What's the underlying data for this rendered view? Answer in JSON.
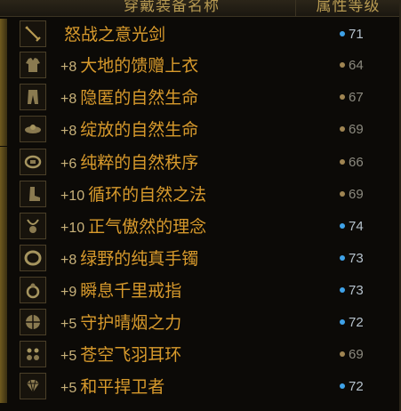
{
  "header": {
    "name_col": "穿戴装备名称",
    "attr_col": "属性等级"
  },
  "rows": [
    {
      "plus": "",
      "name": "怒战之意光剑",
      "level": "71",
      "dot": "blue",
      "icon": "sword-icon"
    },
    {
      "plus": "+8",
      "name": "大地的馈赠上衣",
      "level": "64",
      "dot": "gold",
      "icon": "coat-icon"
    },
    {
      "plus": "+8",
      "name": "隐匿的自然生命",
      "level": "67",
      "dot": "gold",
      "icon": "pants-icon"
    },
    {
      "plus": "+8",
      "name": "绽放的自然生命",
      "level": "69",
      "dot": "gold",
      "icon": "shoulder-icon"
    },
    {
      "plus": "+6",
      "name": "纯粹的自然秩序",
      "level": "66",
      "dot": "gold",
      "icon": "belt-icon"
    },
    {
      "plus": "+10",
      "name": "循环的自然之法",
      "level": "69",
      "dot": "gold",
      "icon": "boots-icon"
    },
    {
      "plus": "+10",
      "name": "正气傲然的理念",
      "level": "74",
      "dot": "blue",
      "icon": "necklace-icon"
    },
    {
      "plus": "+8",
      "name": "绿野的纯真手镯",
      "level": "73",
      "dot": "blue",
      "icon": "bracelet-icon"
    },
    {
      "plus": "+9",
      "name": "瞬息千里戒指",
      "level": "73",
      "dot": "blue",
      "icon": "ring-icon"
    },
    {
      "plus": "+5",
      "name": "守护晴烟之力",
      "level": "72",
      "dot": "blue",
      "icon": "orb-icon"
    },
    {
      "plus": "+5",
      "name": "苍空飞羽耳环",
      "level": "69",
      "dot": "gold",
      "icon": "earring-icon"
    },
    {
      "plus": "+5",
      "name": "和平捍卫者",
      "level": "72",
      "dot": "blue",
      "icon": "gem-icon"
    }
  ]
}
